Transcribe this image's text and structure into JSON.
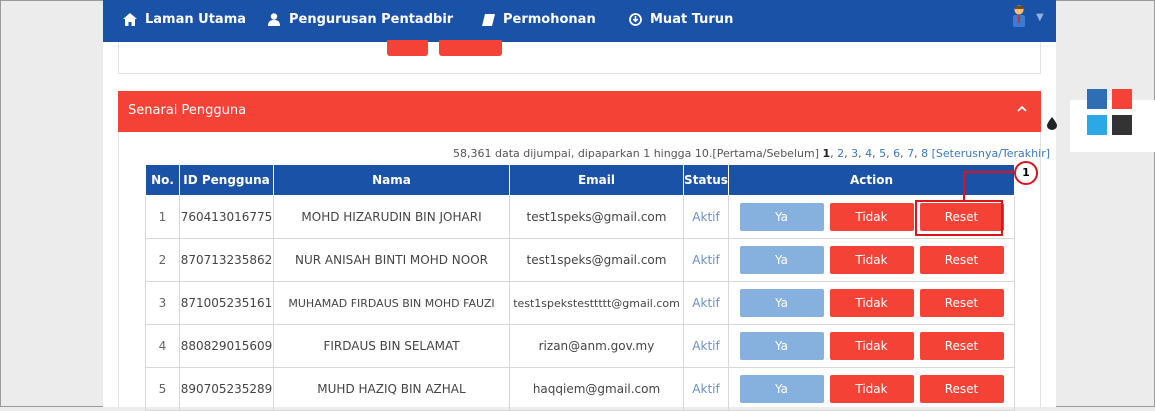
{
  "nav": {
    "items": [
      {
        "label": "Laman Utama",
        "icon": "home-icon"
      },
      {
        "label": "Pengurusan Pentadbir",
        "icon": "user-icon"
      },
      {
        "label": "Permohonan",
        "icon": "book-icon"
      },
      {
        "label": "Muat Turun",
        "icon": "download-circle-icon"
      }
    ]
  },
  "panel": {
    "title": "Senarai Pengguna",
    "collapse_icon": "chevron-up-icon"
  },
  "pager": {
    "summary": "58,361 data dijumpai, dipaparkan 1 hingga 10.",
    "first_prev": "[Pertama/Sebelum]",
    "current": "1",
    "pages": [
      "2",
      "3",
      "4",
      "5",
      "6",
      "7",
      "8"
    ],
    "next_last": "[Seterusnya/Terakhir]"
  },
  "table": {
    "headers": [
      "No.",
      "ID Pengguna",
      "Nama",
      "Email",
      "Status",
      "Action"
    ],
    "rows": [
      {
        "no": "1",
        "id": "760413016775",
        "nama": "MOHD HIZARUDIN BIN JOHARI",
        "email": "test1speks@gmail.com",
        "status": "Aktif"
      },
      {
        "no": "2",
        "id": "870713235862",
        "nama": "NUR ANISAH BINTI MOHD NOOR",
        "email": "test1speks@gmail.com",
        "status": "Aktif"
      },
      {
        "no": "3",
        "id": "871005235161",
        "nama": "MUHAMAD FIRDAUS BIN MOHD FAUZI",
        "email": "test1spekstesttttt@gmail.com",
        "status": "Aktif"
      },
      {
        "no": "4",
        "id": "880829015609",
        "nama": "FIRDAUS BIN SELAMAT",
        "email": "rizan@anm.gov.my",
        "status": "Aktif"
      },
      {
        "no": "5",
        "id": "890705235289",
        "nama": "MUHD HAZIQ BIN AZHAL",
        "email": "haqqiem@gmail.com",
        "status": "Aktif"
      }
    ],
    "btn_ya": "Ya",
    "btn_tidak": "Tidak",
    "btn_reset": "Reset"
  },
  "callout": {
    "number": "1"
  },
  "theme": {
    "icon": "droplet-icon",
    "swatches": [
      "#2f6db5",
      "#f44336",
      "#2ba9e6",
      "#333333"
    ]
  },
  "colors": {
    "primary": "#1a52a8",
    "accent": "#f44336"
  }
}
